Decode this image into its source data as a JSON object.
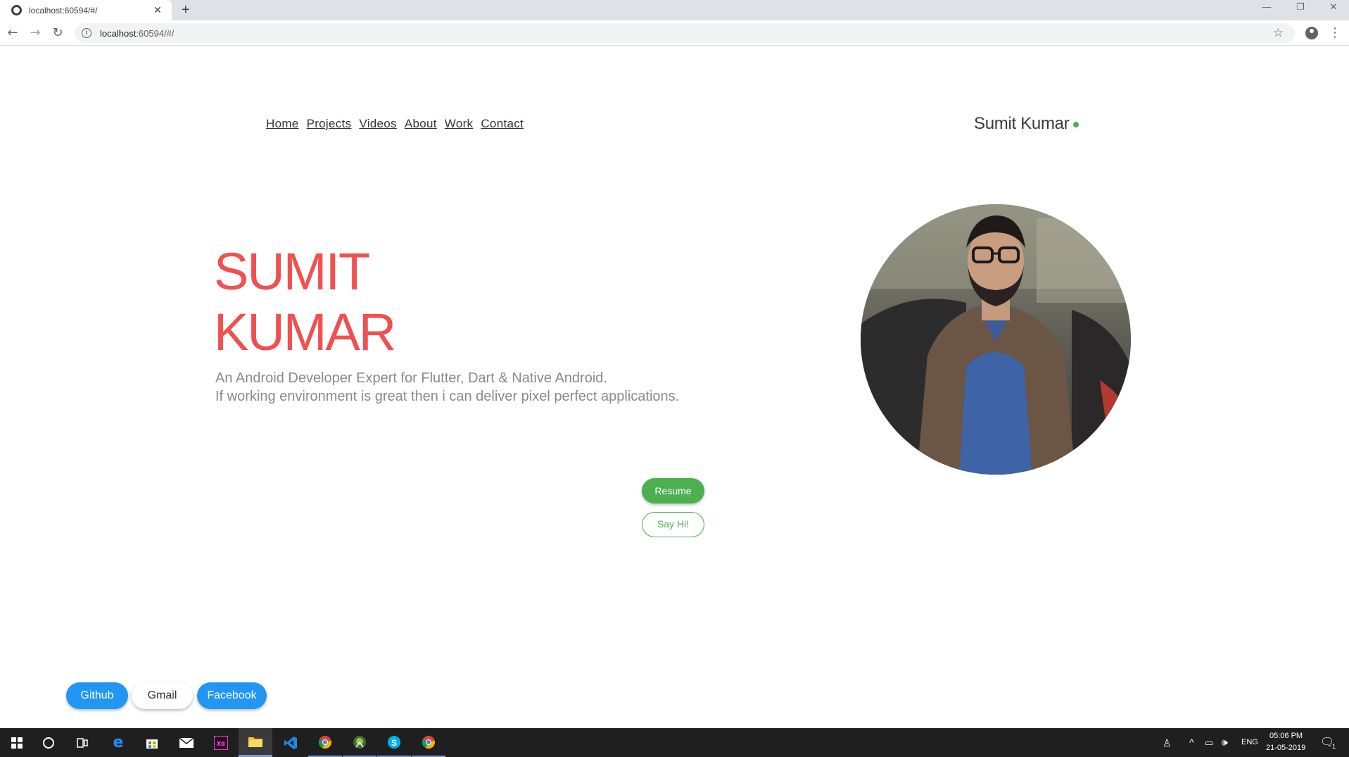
{
  "browser": {
    "tab_title": "localhost:60594/#/",
    "tab_close": "✕",
    "new_tab": "+",
    "url_host": "localhost",
    "url_rest": ":60594/#/",
    "controls": {
      "minimize": "—",
      "restore": "❐",
      "close": "✕"
    }
  },
  "nav": {
    "items": [
      "Home",
      "Projects",
      "Videos",
      "About",
      "Work",
      "Contact"
    ]
  },
  "brand": {
    "name": "Sumit Kumar",
    "dot_color": "#4caf50"
  },
  "hero": {
    "name_line1": "SUMIT",
    "name_line2": "KUMAR",
    "tagline_line1": "An Android Developer Expert for Flutter, Dart & Native Android.",
    "tagline_line2": "If working environment is great then i can deliver pixel perfect applications.",
    "accent_color": "#f05050"
  },
  "actions": {
    "resume": "Resume",
    "say_hi": "Say Hi!"
  },
  "social": {
    "github": "Github",
    "gmail": "Gmail",
    "facebook": "Facebook"
  },
  "colors": {
    "green": "#4caf50",
    "blue": "#2196f3"
  },
  "taskbar": {
    "apps": [
      "windows-start-icon",
      "cortana-icon",
      "task-view-icon",
      "edge-icon",
      "store-icon",
      "mail-icon",
      "adobe-xd-icon",
      "file-explorer-icon",
      "vscode-icon",
      "chrome-icon",
      "android-studio-icon",
      "skype-icon",
      "chrome-icon"
    ],
    "language": "ENG",
    "time": "05:06 PM",
    "date": "21-05-2019",
    "notifications": "1"
  }
}
